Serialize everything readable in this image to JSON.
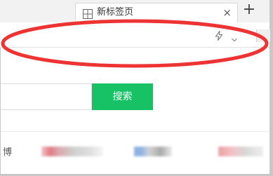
{
  "browser": {
    "tab": {
      "title": "新标签页",
      "icon": "grid-page-icon",
      "close_label": "×"
    },
    "new_tab_label": "+",
    "address_bar": {
      "value": "",
      "icons": [
        "lightning-bolt-icon",
        "chevron-down-icon"
      ]
    }
  },
  "page": {
    "search": {
      "query": "",
      "button_label": "搜索"
    },
    "nav_partial_text": "博"
  },
  "colors": {
    "search_button": "#16c264",
    "annotation_oval": "#ee3333"
  }
}
